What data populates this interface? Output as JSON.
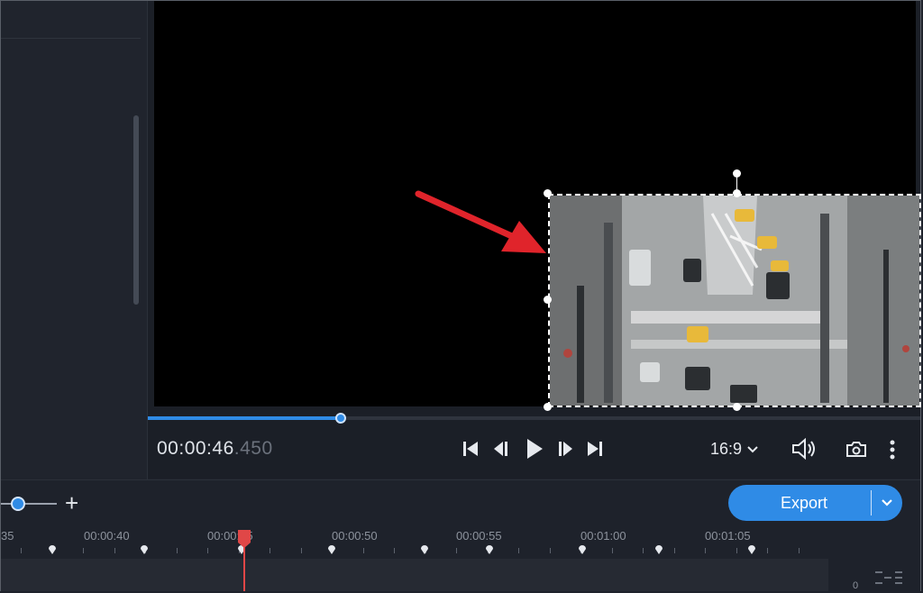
{
  "player": {
    "timecode_main": "00:00:46",
    "timecode_ms": ".450",
    "progress_fraction": 0.25,
    "aspect_ratio": "16:9"
  },
  "icons": {
    "skip_start": "skip-to-start-icon",
    "prev_frame": "previous-frame-icon",
    "play": "play-icon",
    "next_frame": "next-frame-icon",
    "skip_end": "skip-to-end-icon",
    "volume": "volume-icon",
    "snapshot": "camera-icon",
    "more": "more-vertical-icon"
  },
  "timeline": {
    "zoom_plus": "+",
    "export_label": "Export",
    "ruler_labels": [
      "35",
      "00:00:40",
      "00:00:45",
      "00:00:50",
      "00:00:55",
      "00:01:00",
      "00:01:05"
    ],
    "corner_text": "0"
  },
  "colors": {
    "accent": "#2f8be6",
    "playhead": "#e04747",
    "arrow": "#e0242b"
  }
}
